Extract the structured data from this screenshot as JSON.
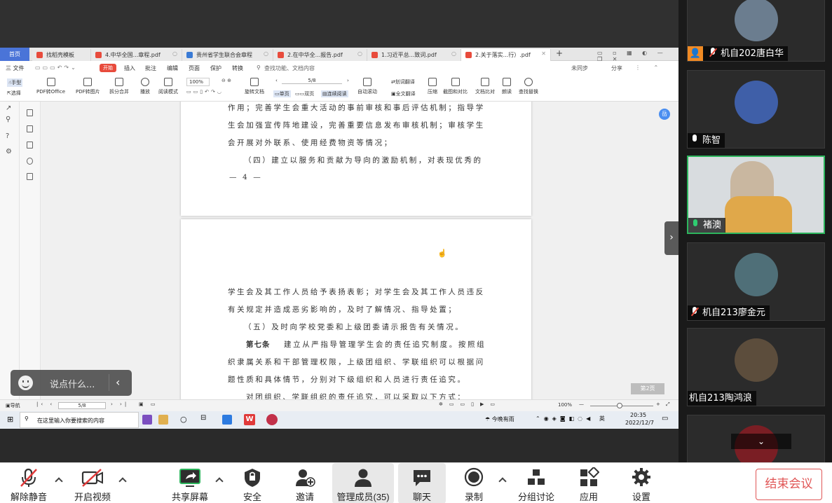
{
  "wps": {
    "home_tab": "首页",
    "tabs": [
      {
        "label": "找稻壳模板",
        "color": "#e84b3c"
      },
      {
        "label": "4.中华全国...章程.pdf",
        "color": "#e84b3c"
      },
      {
        "label": "贵州省学生联合会章程",
        "color": "#3a7bd5"
      },
      {
        "label": "2.在中华全...报告.pdf",
        "color": "#e84b3c"
      },
      {
        "label": "1.习近平总...致词.pdf",
        "color": "#e84b3c"
      },
      {
        "label": "2.关于落实...行）.pdf",
        "color": "#e84b3c"
      }
    ],
    "menu": {
      "file": "三 文件",
      "start": "开始",
      "items": [
        "插入",
        "批注",
        "编辑",
        "页面",
        "保护",
        "转换"
      ],
      "search": "查找功能、文档内容",
      "sync": "未同步",
      "share": "分享"
    },
    "toolbar": {
      "hand": "手型",
      "select": "选择",
      "pdf_to_office": "PDF转Office",
      "pdf_to_image": "PDF转图片",
      "split_merge": "拆分合并",
      "play": "播放",
      "read_mode": "阅读模式",
      "zoom": "100%",
      "page": "5/8",
      "rotate": "旋转文档",
      "single": "单页",
      "double": "双页",
      "continuous": "连续阅读",
      "auto_scroll": "自动滚动",
      "translate": "划词翻译",
      "full_translate": "全文翻译",
      "compress": "压缩",
      "compare": "截图和对比",
      "text_compare": "文档比对",
      "read_aloud": "朗读",
      "find_replace": "查找替换"
    },
    "status": {
      "nav": "导航",
      "page": "5/8",
      "zoom": "100%",
      "next_page": "第2页"
    }
  },
  "document": {
    "page_top_lines": [
      "作用；完善学生会重大活动的事前审核和事后评估机制；指导学",
      "生会加强宣传阵地建设，完善重要信息发布审核机制；审核学生",
      "会开展对外联系、使用经费物资等情况；",
      "（四）建立以服务和贡献为导向的激励机制，对表现优秀的"
    ],
    "page_number": "— 4 —",
    "page_bottom_lines": [
      "学生会及其工作人员给予表扬表彰；对学生会及其工作人员违反",
      "有关规定并造成恶劣影响的，及时了解情况、指导处置；",
      "（五）及时向学校党委和上级团委请示报告有关情况。",
      "建立从严指导管理学生会的责任追究制度。按照组",
      "织隶属关系和干部管理权限，上级团组织、学联组织可以根据问",
      "题性质和具体情节，分别对下级组织和人员进行责任追究。",
      "对团组织、学联组织的责任追究，可以采取以下方式："
    ],
    "article_label": "第七条"
  },
  "taskbar": {
    "search_placeholder": "在这里输入你要搜索的内容",
    "weather": "今晚有雨",
    "time": "20:35",
    "date": "2022/12/7"
  },
  "chat": {
    "placeholder": "说点什么..."
  },
  "participants": [
    {
      "name": "机自202唐白华",
      "mic": "muted",
      "avatar_color": "#6b7d8f"
    },
    {
      "name": "陈智",
      "mic": "on",
      "avatar_color": "#3f5fa8"
    },
    {
      "name": "褚澳",
      "mic": "speaking",
      "avatar_color": "#c9c2b5"
    },
    {
      "name": "机自213廖金元",
      "mic": "muted",
      "avatar_color": "#4f6f78"
    },
    {
      "name": "机自213陶鸿浪",
      "mic": "none",
      "avatar_color": "#5c4d3c"
    },
    {
      "name": "",
      "mic": "none",
      "avatar_color": "#7a1e24"
    }
  ],
  "controls": {
    "mute": "解除静音",
    "video": "开启视频",
    "share": "共享屏幕",
    "security": "安全",
    "invite": "邀请",
    "members": "管理成员(35)",
    "chat": "聊天",
    "record": "录制",
    "breakout": "分组讨论",
    "apps": "应用",
    "settings": "设置",
    "end": "结束会议"
  }
}
